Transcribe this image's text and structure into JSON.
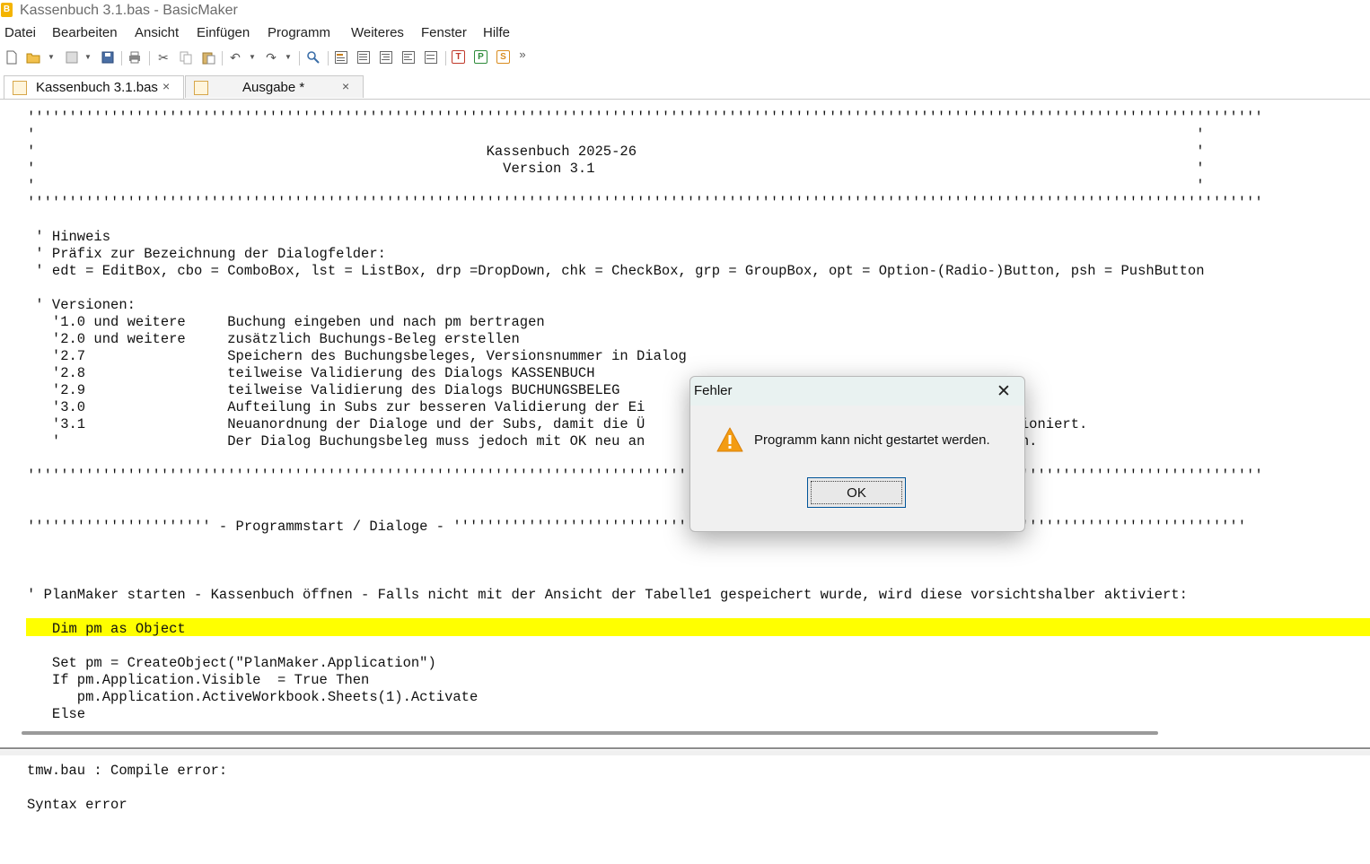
{
  "window": {
    "title": "Kassenbuch 3.1.bas - BasicMaker",
    "app_icon_letter": "B"
  },
  "menu": [
    "Datei",
    "Bearbeiten",
    "Ansicht",
    "Einfügen",
    "Programm",
    "Weiteres",
    "Fenster",
    "Hilfe"
  ],
  "toolbar": {
    "overflow": "»",
    "letters": [
      "T",
      "P",
      "S"
    ]
  },
  "tabs": [
    {
      "label": "Kassenbuch 3.1.bas",
      "close": "×",
      "active": true
    },
    {
      "label": "Ausgabe *",
      "close": "×",
      "active": false
    }
  ],
  "editor": {
    "lines": [
      "''''''''''''''''''''''''''''''''''''''''''''''''''''''''''''''''''''''''''''''''''''''''''''''''''''''''''''''''''''''''''''''''''''''''''''''''''''",
      "'                                                                                                                                           '",
      "'                                                      Kassenbuch 2025-26                                                                   '",
      "'                                                        Version 3.1                                                                        '",
      "'                                                                                                                                           '",
      "''''''''''''''''''''''''''''''''''''''''''''''''''''''''''''''''''''''''''''''''''''''''''''''''''''''''''''''''''''''''''''''''''''''''''''''''''''",
      "",
      " ' Hinweis",
      " ' Präfix zur Bezeichnung der Dialogfelder:",
      " ' edt = EditBox, cbo = ComboBox, lst = ListBox, drp =DropDown, chk = CheckBox, grp = GroupBox, opt = Option-(Radio-)Button, psh = PushButton",
      "",
      " ' Versionen:",
      "   '1.0 und weitere     Buchung eingeben und nach pm bertragen",
      "   '2.0 und weitere     zusätzlich Buchungs-Beleg erstellen",
      "   '2.7                 Speichern des Buchungsbeleges, Versionsnummer in Dialog",
      "   '2.8                 teilweise Validierung des Dialogs KASSENBUCH",
      "   '2.9                 teilweise Validierung des Dialogs BUCHUNGSBELEG",
      "   '3.0                 Aufteilung in Subs zur besseren Validierung der Ei",
      "   '3.1                 Neuanordnung der Dialoge und der Subs, damit die Ü                                 nbeleg funktioniert.",
      "   '                    Der Dialog Buchungsbeleg muss jedoch mit OK neu an                                 nommen werden.",
      "",
      "''''''''''''''''''''''''''''''''''''''''''''''''''''''''''''''''''''''''''''''''''''''''''''''''''''''''''''''''''''''''''''''''''''''''''''''''''''",
      "",
      "",
      "'''''''''''''''''''''' - Programmstart / Dialoge - '''''''''''''''''''''''''''''''''''''''''''''''''''''''''''''''''''''''''''''''''''''''''''''''",
      "",
      "",
      "",
      "' PlanMaker starten - Kassenbuch öffnen - Falls nicht mit der Ansicht der Tabelle1 gespeichert wurde, wird diese vorsichtshalber aktiviert:",
      "",
      "   Dim pm as Object",
      "",
      "   Set pm = CreateObject(\"PlanMaker.Application\")",
      "   If pm.Application.Visible  = True Then",
      "      pm.Application.ActiveWorkbook.Sheets(1).Activate",
      "   Else"
    ]
  },
  "output": {
    "lines": [
      "tmw.bau : Compile error:",
      "",
      "Syntax error"
    ]
  },
  "dialog": {
    "title": "Fehler",
    "close": "✕",
    "message": "Programm kann nicht gestartet werden.",
    "ok_label": "OK",
    "icon": "warning-icon",
    "warning_color": "#f39c12"
  }
}
